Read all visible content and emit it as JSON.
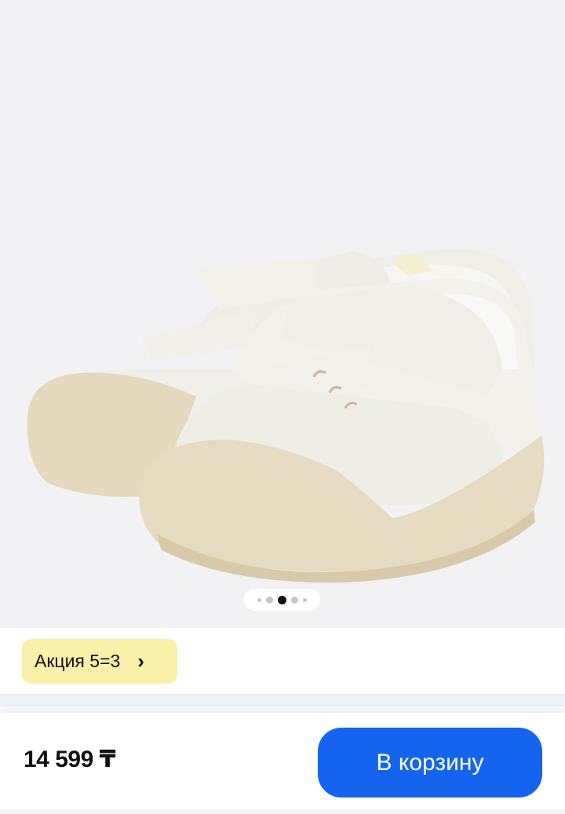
{
  "gallery": {
    "image": "white-leather-baby-sandals",
    "dots_count": 5,
    "active_dot_index": 2
  },
  "promo": {
    "label": "Акция 5=3",
    "chevron": "›",
    "icon": "chevron-right-icon",
    "background": "#fbf0aa"
  },
  "footer": {
    "price": "14 599 ₸",
    "cart_button_label": "В корзину",
    "accent": "#1464f0"
  }
}
